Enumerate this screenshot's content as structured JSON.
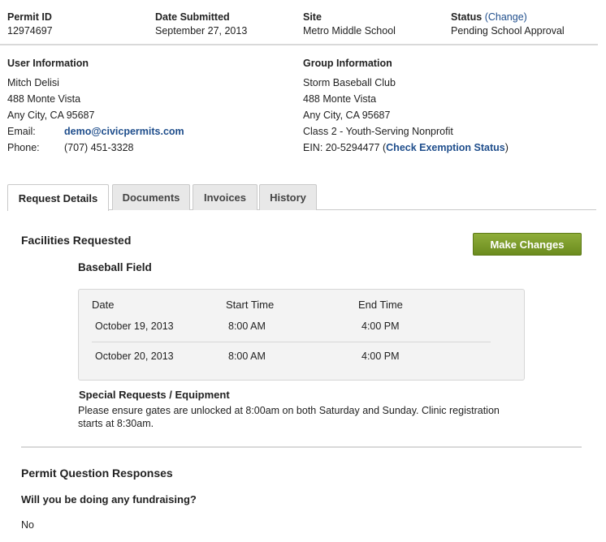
{
  "header": {
    "permit_id_label": "Permit ID",
    "permit_id": "12974697",
    "date_label": "Date Submitted",
    "date": "September 27, 2013",
    "site_label": "Site",
    "site": "Metro Middle School",
    "status_label": "Status",
    "status_change_open": "(",
    "status_change": "Change",
    "status_change_close": ")",
    "status": "Pending School Approval"
  },
  "user": {
    "heading": "User Information",
    "name": "Mitch Delisi",
    "address1": "488 Monte Vista",
    "address2": "Any City, CA 95687",
    "email_label": "Email:",
    "email": "demo@civicpermits.com",
    "phone_label": "Phone:",
    "phone": "(707) 451-3328"
  },
  "group": {
    "heading": "Group Information",
    "name": "Storm Baseball Club",
    "address1": "488 Monte Vista",
    "address2": "Any City, CA 95687",
    "class": "Class 2 - Youth-Serving Nonprofit",
    "ein": "EIN: 20-5294477 (",
    "ein_link": "Check Exemption Status",
    "ein_close": ")"
  },
  "tabs": [
    {
      "label": "Request Details"
    },
    {
      "label": "Documents"
    },
    {
      "label": "Invoices"
    },
    {
      "label": "History"
    }
  ],
  "facilities": {
    "heading": "Facilities Requested",
    "make_changes": "Make Changes",
    "facility_name": "Baseball Field",
    "columns": [
      "Date",
      "Start Time",
      "End Time"
    ],
    "rows": [
      {
        "date": "October 19, 2013",
        "start": "8:00 AM",
        "end": "4:00 PM"
      },
      {
        "date": "October 20, 2013",
        "start": "8:00 AM",
        "end": "4:00 PM"
      }
    ],
    "special_heading": "Special Requests / Equipment",
    "special_line1": "Please ensure gates are unlocked at 8:00am on both Saturday and Sunday. Clinic registration",
    "special_line2": "starts at 8:30am."
  },
  "questions": {
    "heading": "Permit Question Responses",
    "q1": "Will you be doing any fundraising?",
    "a1": "No"
  }
}
